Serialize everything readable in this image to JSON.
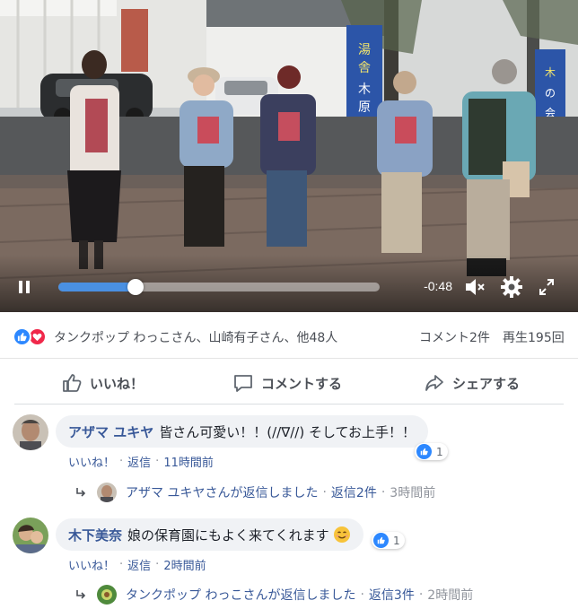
{
  "video": {
    "time_remaining": "-0:48",
    "progress_fraction": 0.24,
    "banner_left": "湯舎・木原の会",
    "banner_right": "木の会"
  },
  "stats": {
    "reaction_names": "タンクポップ わっこさん、山崎有子さん、他48人",
    "comment_count": "コメント2件",
    "view_count": "再生195回"
  },
  "actions": {
    "like": "いいね！",
    "comment": "コメントする",
    "share": "シェアする"
  },
  "comments": [
    {
      "author": "アザマ ユキヤ",
      "text": "皆さん可愛い！！(//∇//) そしてお上手！！",
      "likes": "1",
      "like_label": "いいね！",
      "reply_label": "返信",
      "time": "11時間前",
      "reply_summary": {
        "text": "アザマ ユキヤさんが返信しました",
        "count": "返信2件",
        "time": "3時間前"
      }
    },
    {
      "author": "木下美奈",
      "text": "娘の保育園にもよく来てくれます",
      "likes": "1",
      "like_label": "いいね！",
      "reply_label": "返信",
      "time": "2時間前",
      "reply_summary": {
        "text": "タンクポップ わっこさんが返信しました",
        "count": "返信3件",
        "time": "2時間前"
      }
    }
  ],
  "colors": {
    "link": "#385898",
    "like_blue": "#2d88ff",
    "love_red": "#f0284a",
    "progress": "#4a90e2"
  }
}
